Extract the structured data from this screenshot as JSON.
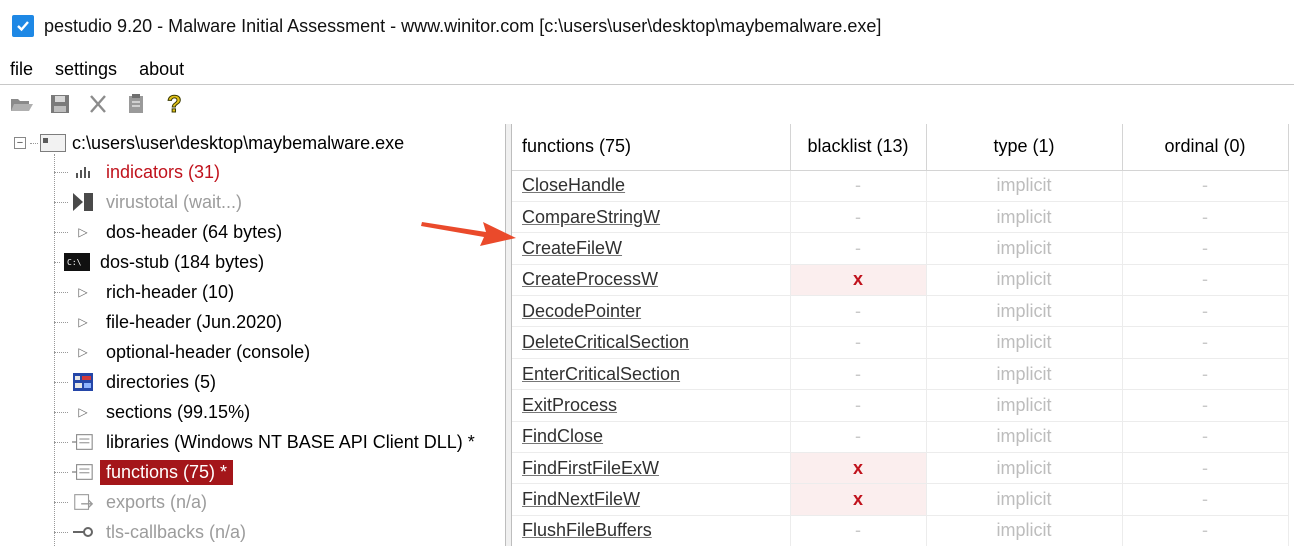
{
  "window": {
    "title": "pestudio 9.20 - Malware Initial Assessment - www.winitor.com [c:\\users\\user\\desktop\\maybemalware.exe]",
    "icon": "checkbox-icon"
  },
  "menu": [
    "file",
    "settings",
    "about"
  ],
  "toolbar": {
    "buttons": [
      "open-folder-icon",
      "save-icon",
      "cut-icon",
      "clipboard-icon",
      "help-icon"
    ]
  },
  "tree": {
    "root": "c:\\users\\user\\desktop\\maybemalware.exe",
    "items": [
      {
        "label": "indicators (31)",
        "icon": "bar-chart-icon",
        "style": "red"
      },
      {
        "label": "virustotal (wait...)",
        "icon": "virustotal-icon",
        "style": "gray"
      },
      {
        "label": "dos-header (64 bytes)",
        "icon": "expand-arrow-icon",
        "style": "normal"
      },
      {
        "label": "dos-stub (184 bytes)",
        "icon": "console-icon",
        "style": "normal"
      },
      {
        "label": "rich-header (10)",
        "icon": "expand-arrow-icon",
        "style": "normal"
      },
      {
        "label": "file-header (Jun.2020)",
        "icon": "expand-arrow-icon",
        "style": "normal"
      },
      {
        "label": "optional-header (console)",
        "icon": "expand-arrow-icon",
        "style": "normal"
      },
      {
        "label": "directories (5)",
        "icon": "directories-icon",
        "style": "normal"
      },
      {
        "label": "sections (99.15%)",
        "icon": "expand-arrow-icon",
        "style": "normal"
      },
      {
        "label": "libraries (Windows NT BASE API Client DLL) *",
        "icon": "library-icon",
        "style": "normal"
      },
      {
        "label": "functions (75) *",
        "icon": "library-icon",
        "style": "selected"
      },
      {
        "label": "exports (n/a)",
        "icon": "export-icon",
        "style": "gray"
      },
      {
        "label": "tls-callbacks (n/a)",
        "icon": "key-icon",
        "style": "gray"
      }
    ]
  },
  "table": {
    "columns": [
      "functions (75)",
      "blacklist (13)",
      "type (1)",
      "ordinal (0)"
    ],
    "rows": [
      {
        "name": "CloseHandle",
        "blacklist": "-",
        "flagged": false,
        "type": "implicit",
        "ordinal": "-"
      },
      {
        "name": "CompareStringW",
        "blacklist": "-",
        "flagged": false,
        "type": "implicit",
        "ordinal": "-"
      },
      {
        "name": "CreateFileW",
        "blacklist": "-",
        "flagged": false,
        "type": "implicit",
        "ordinal": "-"
      },
      {
        "name": "CreateProcessW",
        "blacklist": "x",
        "flagged": true,
        "type": "implicit",
        "ordinal": "-"
      },
      {
        "name": "DecodePointer",
        "blacklist": "-",
        "flagged": false,
        "type": "implicit",
        "ordinal": "-"
      },
      {
        "name": "DeleteCriticalSection",
        "blacklist": "-",
        "flagged": false,
        "type": "implicit",
        "ordinal": "-"
      },
      {
        "name": "EnterCriticalSection",
        "blacklist": "-",
        "flagged": false,
        "type": "implicit",
        "ordinal": "-"
      },
      {
        "name": "ExitProcess",
        "blacklist": "-",
        "flagged": false,
        "type": "implicit",
        "ordinal": "-"
      },
      {
        "name": "FindClose",
        "blacklist": "-",
        "flagged": false,
        "type": "implicit",
        "ordinal": "-"
      },
      {
        "name": "FindFirstFileExW",
        "blacklist": "x",
        "flagged": true,
        "type": "implicit",
        "ordinal": "-"
      },
      {
        "name": "FindNextFileW",
        "blacklist": "x",
        "flagged": true,
        "type": "implicit",
        "ordinal": "-"
      },
      {
        "name": "FlushFileBuffers",
        "blacklist": "-",
        "flagged": false,
        "type": "implicit",
        "ordinal": "-"
      }
    ]
  },
  "annotation": {
    "arrow_color": "#ea4a2b"
  },
  "colors": {
    "accent": "#1e88e5",
    "selected": "#a4161a",
    "alert": "#c0121c"
  }
}
